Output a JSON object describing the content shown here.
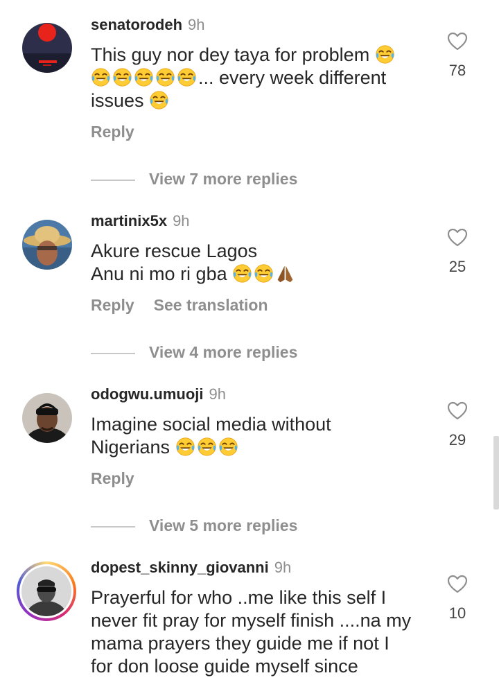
{
  "comments": [
    {
      "username": "senatorodeh",
      "time": "9h",
      "line1": "This guy nor dey taya for problem",
      "line2_suffix": "... every week different",
      "line3": "issues",
      "reply": "Reply",
      "likes": "78",
      "view_replies": "View 7 more replies",
      "avatar_icon": "sunset-avatar"
    },
    {
      "username": "martinix5x",
      "time": "9h",
      "line1": "Akure rescue Lagos",
      "line2": "Anu ni mo ri gba",
      "reply": "Reply",
      "see_translation": "See translation",
      "likes": "25",
      "view_replies": "View 4 more replies",
      "avatar_icon": "straw-hat-avatar"
    },
    {
      "username": "odogwu.umuoji",
      "time": "9h",
      "line1": "Imagine social media without",
      "line2": "Nigerians",
      "reply": "Reply",
      "likes": "29",
      "view_replies": "View 5 more replies",
      "avatar_icon": "beanie-man-avatar"
    },
    {
      "username": "dopest_skinny_giovanni",
      "time": "9h",
      "line1": "Prayerful for who ..me like this self I",
      "line2": "never fit pray for myself finish ....na my",
      "line3": "mama prayers they guide me if not I",
      "line4": "for don loose guide myself since",
      "likes": "10",
      "avatar_icon": "sunglasses-man-avatar"
    }
  ],
  "emoji": {
    "laugh": "face-with-tears-of-joy-icon",
    "pray": "folded-hands-icon"
  },
  "colors": {
    "text": "#262626",
    "secondary": "#8e8e8e",
    "emoji_yellow": "#FFCC33",
    "story_ring": "#d62976"
  }
}
